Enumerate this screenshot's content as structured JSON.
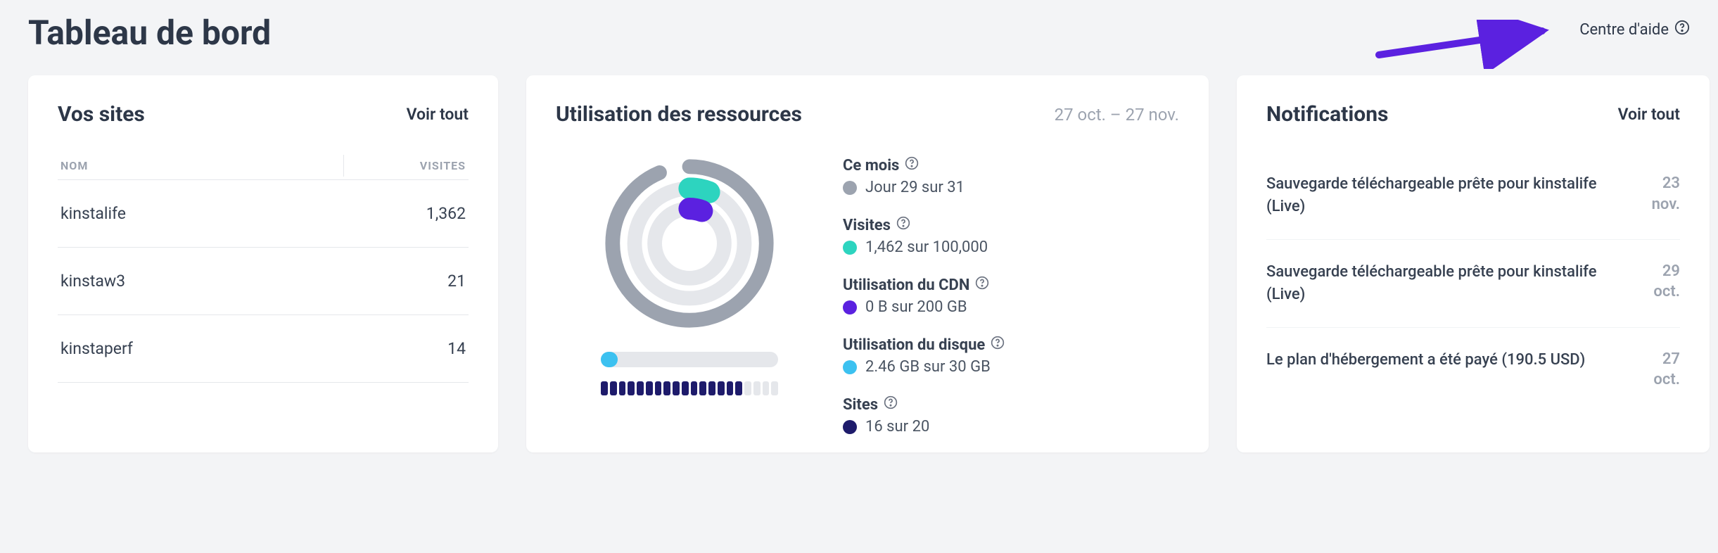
{
  "page_title": "Tableau de bord",
  "help_center_label": "Centre d'aide",
  "colors": {
    "month_gray": "#9ca3af",
    "visits_teal": "#2dd4bf",
    "cdn_purple": "#5b21e0",
    "disk_blue": "#3cc1f0",
    "sites_navy": "#1e1b6b"
  },
  "sites_card": {
    "title": "Vos sites",
    "view_all": "Voir tout",
    "col_name": "NOM",
    "col_visits": "VISITES",
    "rows": [
      {
        "name": "kinstalife",
        "visits": "1,362"
      },
      {
        "name": "kinstaw3",
        "visits": "21"
      },
      {
        "name": "kinstaperf",
        "visits": "14"
      }
    ]
  },
  "resources_card": {
    "title": "Utilisation des ressources",
    "date_range": "27 oct. – 27 nov.",
    "this_month_label": "Ce mois",
    "this_month_value": "Jour 29 sur 31",
    "visits_label": "Visites",
    "visits_value": "1,462 sur 100,000",
    "cdn_label": "Utilisation du CDN",
    "cdn_value": "0 B sur 200 GB",
    "disk_label": "Utilisation du disque",
    "disk_value": "2.46 GB sur 30 GB",
    "sites_label": "Sites",
    "sites_value": "16 sur 20"
  },
  "notifications_card": {
    "title": "Notifications",
    "view_all": "Voir tout",
    "items": [
      {
        "text": "Sauvegarde téléchargeable prête pour kinstalife (Live)",
        "day": "23",
        "month": "nov."
      },
      {
        "text": "Sauvegarde téléchargeable prête pour kinstalife (Live)",
        "day": "29",
        "month": "oct."
      },
      {
        "text": "Le plan d'hébergement a été payé (190.5 USD)",
        "day": "27",
        "month": "oct."
      }
    ]
  },
  "chart_data": {
    "type": "donut-progress",
    "rings": [
      {
        "name": "Ce mois (jours)",
        "value": 29,
        "max": 31,
        "color": "#9ca3af"
      },
      {
        "name": "Visites",
        "value": 1462,
        "max": 100000,
        "color": "#2dd4bf"
      },
      {
        "name": "Utilisation du CDN (GB)",
        "value": 0,
        "max": 200,
        "color": "#5b21e0"
      }
    ],
    "linear": [
      {
        "name": "Utilisation du disque (GB)",
        "value": 2.46,
        "max": 30,
        "color": "#3cc1f0"
      },
      {
        "name": "Sites",
        "value": 16,
        "max": 20,
        "color": "#1e1b6b"
      }
    ]
  }
}
